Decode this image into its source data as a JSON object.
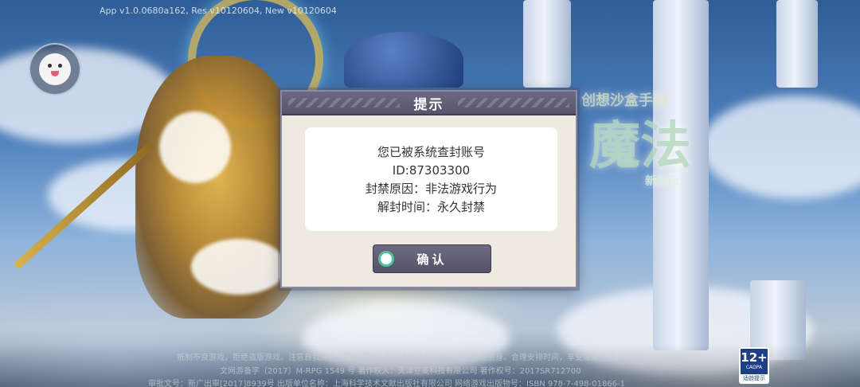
{
  "version_text": "App v1.0.0680a162, Res v10120604, New v10120604",
  "game_logo": {
    "subtitle": "创想沙盒手游",
    "title": "魔法",
    "tagline": "新纪元"
  },
  "dialog": {
    "title": "提示",
    "message_lines": [
      "您已被系统查封账号",
      "ID:87303300",
      "封禁原因：非法游戏行为",
      "解封时间：永久封禁"
    ],
    "confirm_label": "确认"
  },
  "footer": {
    "line1": "抵制不良游戏，拒绝盗版游戏。注意自我保护，谨防受骗上当。适度游戏益脑，沉迷游戏伤身。合理安排时间，享受健康生活。",
    "line2": "文网游备字〔2017〕M-RPG 1549 号  著作权人：天津豆麦科技有限公司  著作权号：2017SR712700",
    "line3": "审批文号：新广出审[2017]8939号  出版单位名称：上海科学技术文献出版社有限公司  网络游戏出版物号：ISBN 978-7-498-01866-1"
  },
  "age_rating": {
    "value": "12+",
    "org": "CADPA",
    "tip": "适龄提示"
  },
  "colors": {
    "dialog_header": "#5f5c74",
    "dialog_body": "#efeadf",
    "confirm_ring": "#4fc3a1"
  }
}
